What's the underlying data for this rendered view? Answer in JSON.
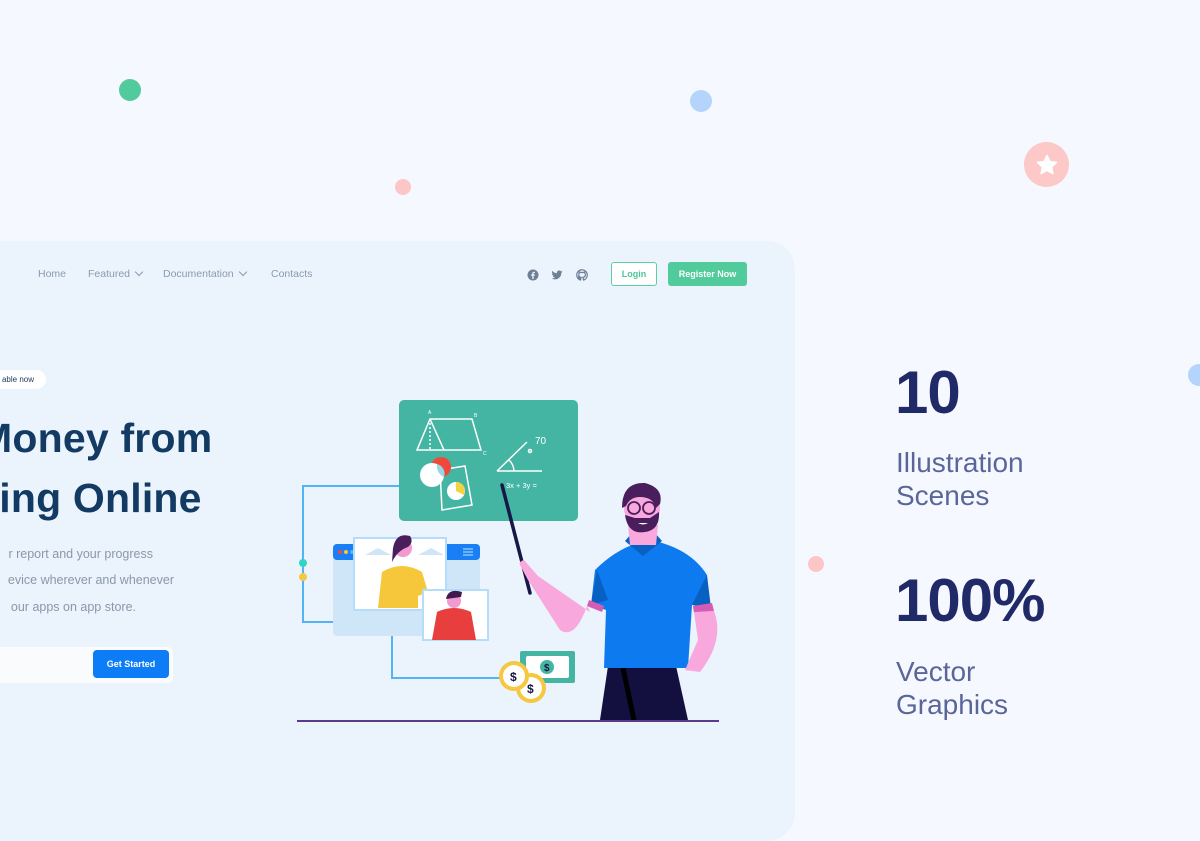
{
  "colors": {
    "background": "#f5f9ff",
    "card": "#ebf3fc",
    "green_accent": "#52cb9c",
    "blue_accent": "#0c7cf7",
    "headline": "#123a63",
    "stat_number": "#202a66",
    "stat_label": "#5a6699"
  },
  "nav": {
    "items": [
      {
        "label": "Home",
        "has_dropdown": false
      },
      {
        "label": "Featured",
        "has_dropdown": true
      },
      {
        "label": "Documentation",
        "has_dropdown": true
      },
      {
        "label": "Contacts",
        "has_dropdown": false
      }
    ],
    "social_icons": [
      "facebook-icon",
      "twitter-icon",
      "github-icon"
    ],
    "login_label": "Login",
    "register_label": "Register Now"
  },
  "hero": {
    "badge": "able now",
    "headline_line1": "Money from",
    "headline_line2": "ning Online",
    "description_lines": [
      "r report and your progress",
      "evice wherever and whenever",
      " our apps on app store."
    ],
    "cta_label": "Get Started"
  },
  "illustration": {
    "board_text_angle": "70",
    "board_text_equation": "3x + 3y =",
    "board_labels": [
      "A",
      "B",
      "C"
    ],
    "money_symbol": "$"
  },
  "stats": [
    {
      "number": "10",
      "label_line1": "Illustration",
      "label_line2": "Scenes"
    },
    {
      "number": "100%",
      "label_line1": "Vector",
      "label_line2": "Graphics"
    }
  ]
}
